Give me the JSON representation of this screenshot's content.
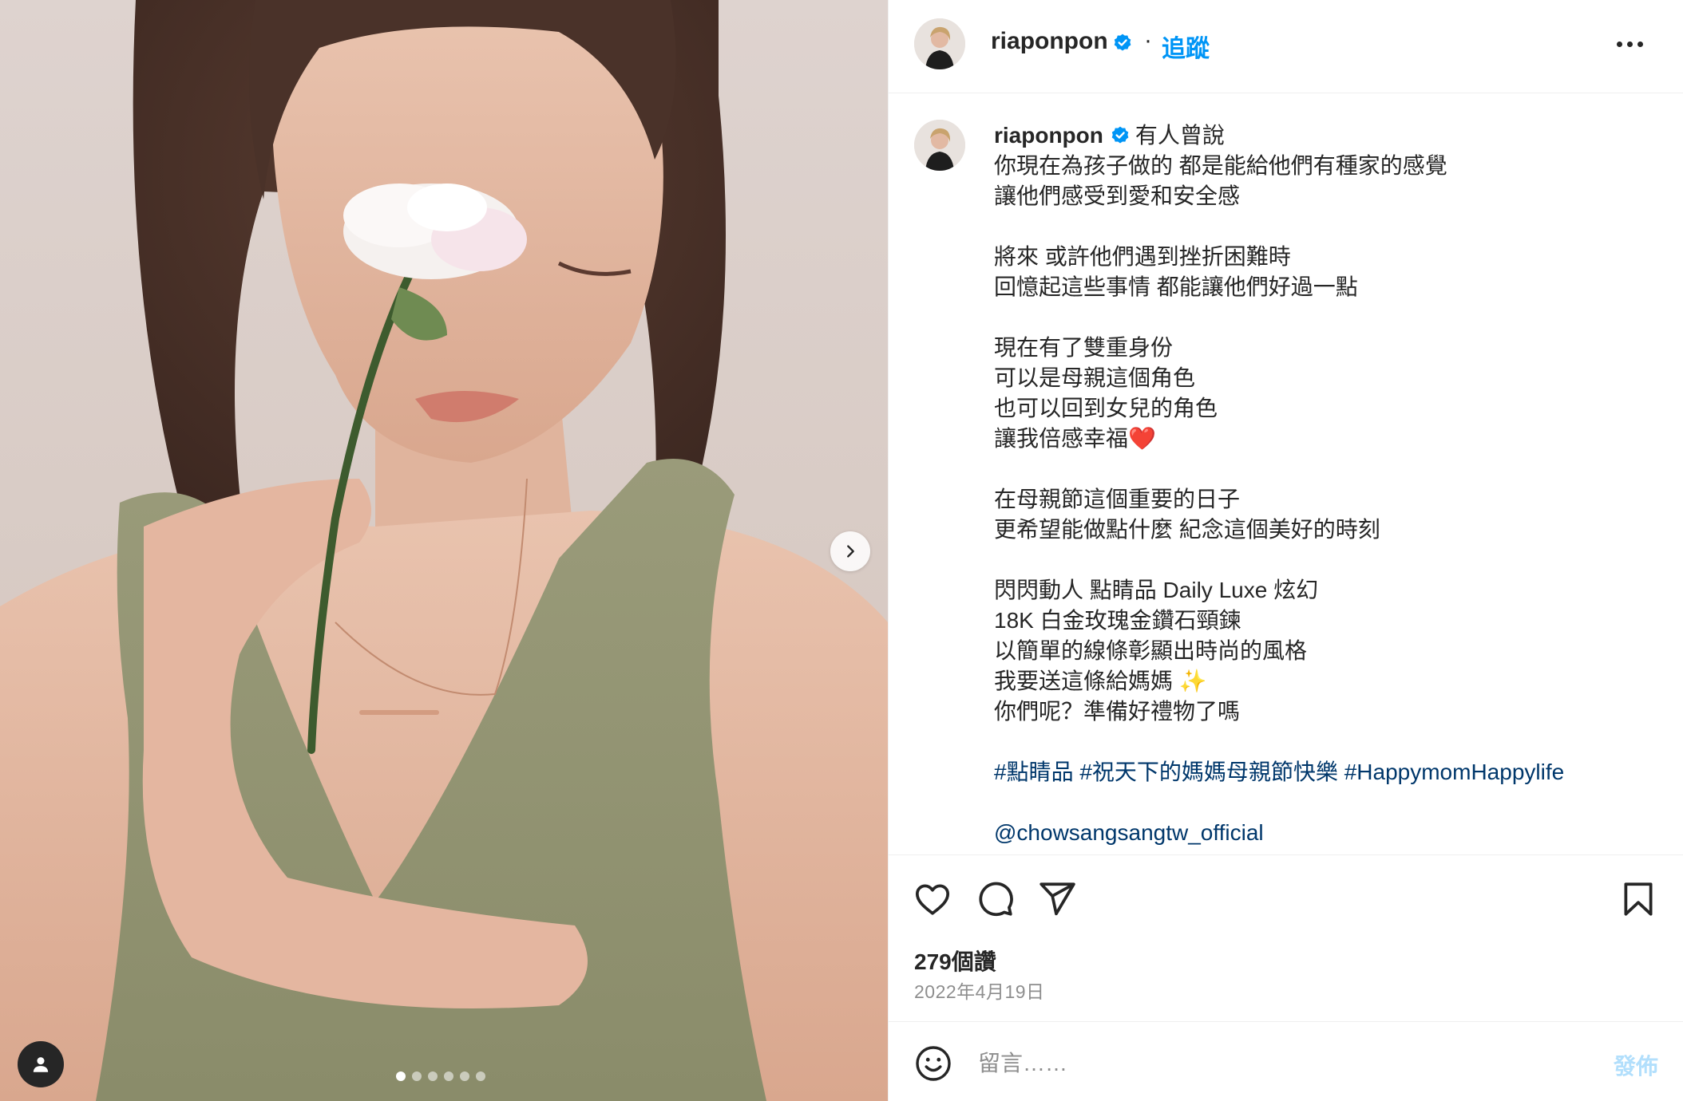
{
  "post": {
    "username": "riaponpon",
    "follow_label": "追蹤",
    "separator": "·",
    "caption_first": "有人曾說",
    "caption_lines": [
      "你現在為孩子做的 都是能給他們有種家的感覺",
      "讓他們感受到愛和安全感",
      "",
      "將來 或許他們遇到挫折困難時",
      "回憶起這些事情 都能讓他們好過一點",
      "",
      "現在有了雙重身份",
      "可以是母親這個角色",
      "也可以回到女兒的角色",
      "讓我倍感幸福❤️",
      "",
      "在母親節這個重要的日子",
      "更希望能做點什麼 紀念這個美好的時刻",
      "",
      "閃閃動人 點睛品 Daily Luxe 炫幻",
      "18K 白金玫瑰金鑽石頸鍊",
      "以簡單的線條彰顯出時尚的風格",
      "我要送這條給媽媽 ✨",
      "你們呢？準備好禮物了嗎",
      ""
    ],
    "hashtags": [
      "#點睛品",
      "#祝天下的媽媽母親節快樂",
      "#HappymomHappylife"
    ],
    "mention": "@chowsangsangtw_official",
    "likes": "279個讚",
    "date": "2022年4月19日"
  },
  "carousel": {
    "count": 6,
    "active_index": 0
  },
  "comment": {
    "placeholder": "留言……",
    "post_label": "發佈"
  },
  "icons": {
    "header": [
      "verified-badge-icon",
      "more-options-icon"
    ],
    "actions": [
      "heart-icon",
      "comment-icon",
      "share-icon",
      "bookmark-icon"
    ],
    "other": [
      "chevron-right-icon",
      "user-tag-icon",
      "emoji-icon"
    ]
  },
  "colors": {
    "link_blue": "#0095f6",
    "hashtag_blue": "#00376b",
    "verified_blue": "#0095f6",
    "muted_text": "#8e8e8e",
    "post_button_disabled": "#b2dffc"
  }
}
